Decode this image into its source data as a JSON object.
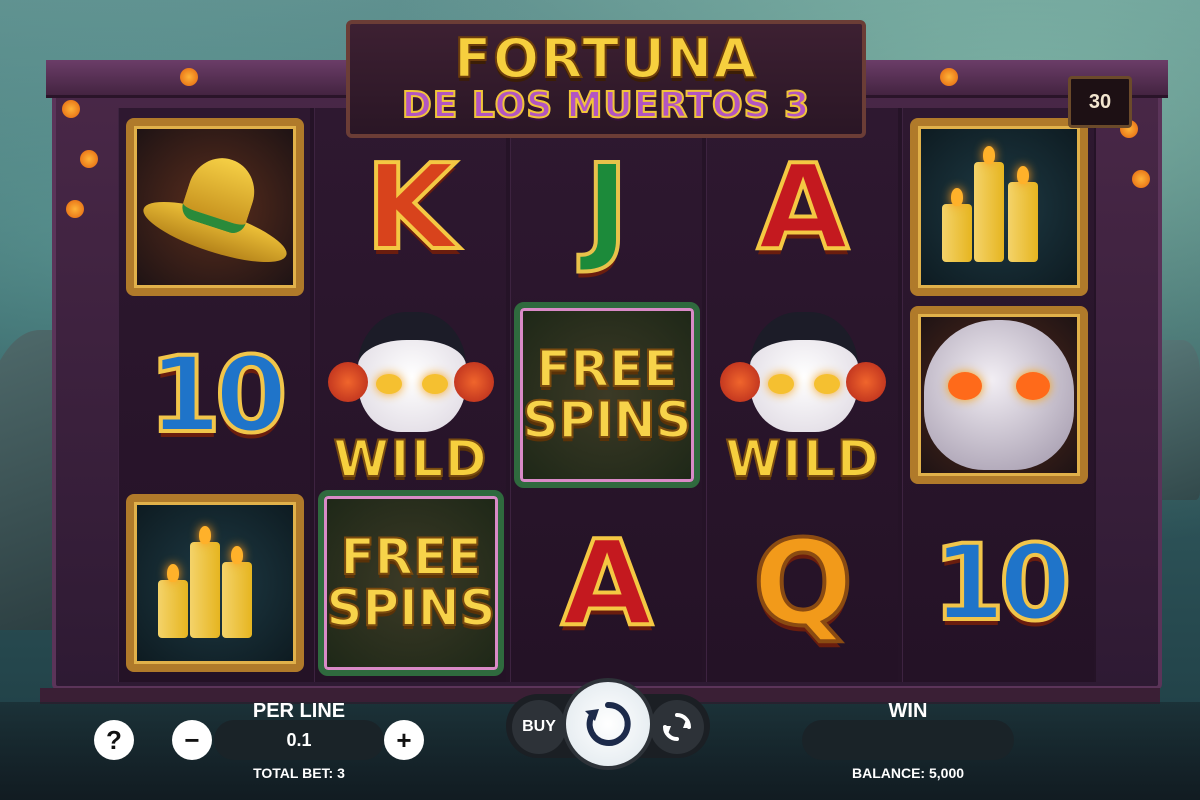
{
  "game": {
    "title_line1": "FORTUNA",
    "title_line2": "DE LOS MUERTOS 3",
    "lines_count": "30"
  },
  "reels": [
    [
      {
        "symbol": "sombrero"
      },
      {
        "symbol": "10"
      },
      {
        "symbol": "candles"
      }
    ],
    [
      {
        "symbol": "K"
      },
      {
        "symbol": "wild",
        "text": "WILD"
      },
      {
        "symbol": "free-spins",
        "line1": "FREE",
        "line2": "SPINS"
      }
    ],
    [
      {
        "symbol": "J"
      },
      {
        "symbol": "free-spins",
        "line1": "FREE",
        "line2": "SPINS"
      },
      {
        "symbol": "A"
      }
    ],
    [
      {
        "symbol": "A"
      },
      {
        "symbol": "wild",
        "text": "WILD"
      },
      {
        "symbol": "Q"
      }
    ],
    [
      {
        "symbol": "candles"
      },
      {
        "symbol": "sugar-skull"
      },
      {
        "symbol": "10"
      }
    ]
  ],
  "controls": {
    "help_label": "?",
    "per_line_label": "PER LINE",
    "per_line_value": "0.1",
    "minus_label": "−",
    "plus_label": "+",
    "total_bet_text": "TOTAL BET: 3",
    "buy_label": "BUY",
    "win_label": "WIN",
    "win_value": "",
    "balance_text": "BALANCE: 5,000"
  },
  "colors": {
    "accent_gold": "#f6cf3e",
    "title_purple": "#b255c2",
    "control_bar": "#1a2328"
  }
}
